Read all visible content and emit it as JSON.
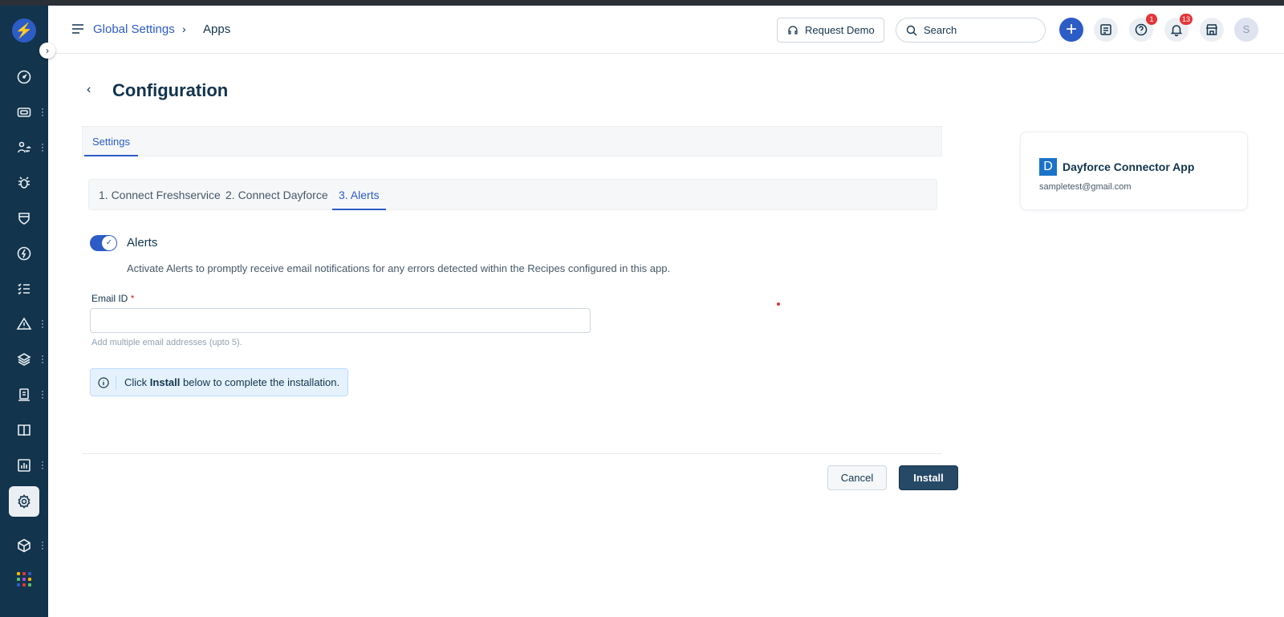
{
  "colors": {
    "brand": "#2c5cc5",
    "rail": "#12344d",
    "badge": "#e43538",
    "install_button": "#264966"
  },
  "rail": {
    "expand_icon": "chevron-right-icon",
    "items": [
      {
        "icon": "dashboard-icon",
        "menu": false
      },
      {
        "icon": "ticket-icon",
        "menu": true
      },
      {
        "icon": "changes-icon",
        "menu": true
      },
      {
        "icon": "bug-icon",
        "menu": false
      },
      {
        "icon": "shield-icon",
        "menu": false
      },
      {
        "icon": "bolt-icon",
        "menu": false
      },
      {
        "icon": "checklist-icon",
        "menu": false
      },
      {
        "icon": "alert-icon",
        "menu": true
      },
      {
        "icon": "layers-icon",
        "menu": true
      },
      {
        "icon": "document-icon",
        "menu": true
      },
      {
        "icon": "book-icon",
        "menu": false
      },
      {
        "icon": "reports-icon",
        "menu": true
      },
      {
        "icon": "settings-icon",
        "menu": false,
        "active": true
      },
      {
        "icon": "cube-icon",
        "menu": true
      },
      {
        "icon": "apps-grid-icon",
        "menu": false
      }
    ]
  },
  "header": {
    "breadcrumb_root": "Global Settings",
    "breadcrumb_current": "Apps",
    "request_demo": "Request Demo",
    "search_placeholder": "Search",
    "help_badge": "1",
    "notifications_badge": "13",
    "avatar_initial": "S"
  },
  "page": {
    "title": "Configuration",
    "settings_tab": "Settings",
    "steps": [
      "1. Connect Freshservice",
      "2. Connect Dayforce",
      "3. Alerts"
    ],
    "active_step": 2,
    "alerts_title": "Alerts",
    "alerts_enabled": true,
    "alerts_desc": "Activate Alerts to promptly receive email notifications for any errors detected within the Recipes configured in this app.",
    "email_label": "Email ID",
    "email_required_mark": "*",
    "email_value": "",
    "email_hint": "Add multiple email addresses (upto 5).",
    "info_click": "Click",
    "info_install": "Install",
    "info_rest": "below to complete the installation.",
    "cancel_label": "Cancel",
    "install_label": "Install"
  },
  "app_card": {
    "logo_letter": "D",
    "name": "Dayforce Connector App",
    "email": "sampletest@gmail.com"
  }
}
